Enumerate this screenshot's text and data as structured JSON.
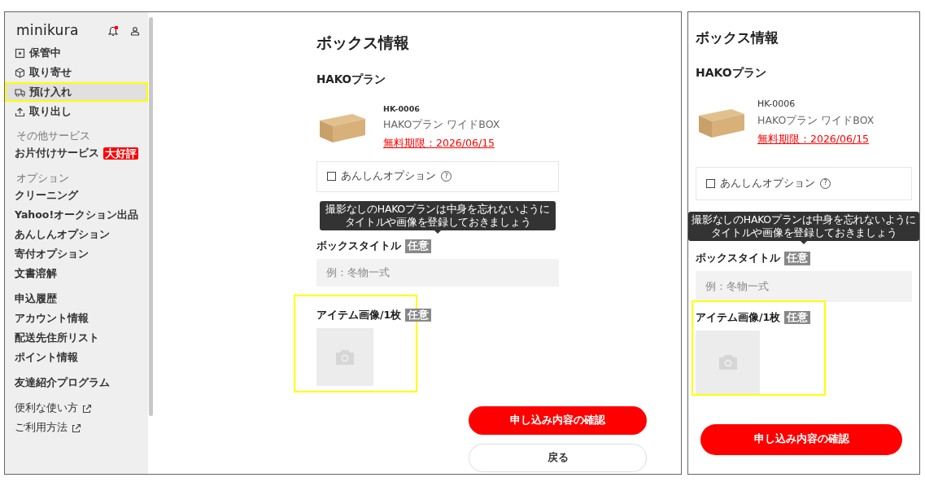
{
  "desktop": {
    "sidebar": {
      "logo": "minikura",
      "has_notification": true,
      "sections": [
        {
          "items": [
            {
              "label": "保管中",
              "kind": "nav",
              "selected": false,
              "highlighted": false
            },
            {
              "label": "取り寄せ",
              "kind": "nav",
              "selected": false,
              "highlighted": false
            },
            {
              "label": "預け入れ",
              "kind": "nav",
              "selected": true,
              "highlighted": true
            },
            {
              "label": "取り出し",
              "kind": "nav",
              "selected": false,
              "highlighted": false
            }
          ]
        },
        {
          "heading": "その他サービス",
          "items": [
            {
              "label": "お片付けサービス",
              "kind": "nav",
              "badge": "大好評",
              "selected": false,
              "highlighted": false
            }
          ]
        },
        {
          "heading": "オプション",
          "items": [
            {
              "label": "クリーニング",
              "kind": "nav",
              "selected": false,
              "highlighted": false
            },
            {
              "label": "Yahoo!オークション出品",
              "kind": "nav",
              "selected": false,
              "highlighted": false
            },
            {
              "label": "あんしんオプション",
              "kind": "nav",
              "selected": false,
              "highlighted": false
            },
            {
              "label": "寄付オプション",
              "kind": "nav",
              "selected": false,
              "highlighted": false
            },
            {
              "label": "文書溶解",
              "kind": "nav",
              "selected": false,
              "highlighted": false
            }
          ]
        },
        {
          "items": [
            {
              "label": "申込履歴",
              "kind": "nav",
              "selected": false,
              "highlighted": false
            },
            {
              "label": "アカウント情報",
              "kind": "nav",
              "selected": false,
              "highlighted": false
            },
            {
              "label": "配送先住所リスト",
              "kind": "nav",
              "selected": false,
              "highlighted": false
            },
            {
              "label": "ポイント情報",
              "kind": "nav",
              "selected": false,
              "highlighted": false
            }
          ]
        },
        {
          "items": [
            {
              "label": "友達紹介プログラム",
              "kind": "nav",
              "selected": false,
              "highlighted": false
            }
          ]
        },
        {
          "items": [
            {
              "label": "便利な使い方",
              "kind": "external",
              "selected": false,
              "highlighted": false
            },
            {
              "label": "ご利用方法",
              "kind": "external",
              "selected": false,
              "highlighted": false
            }
          ]
        }
      ]
    },
    "main": {
      "title": "ボックス情報",
      "plan_title": "HAKOプラン",
      "product": {
        "code": "HK-0006",
        "name": "HAKOプラン ワイドBOX",
        "deadline": "無料期限：2026/06/15"
      },
      "option": {
        "label": "あんしんオプション",
        "checked": false,
        "help": "?"
      },
      "tooltip": {
        "lines": [
          "撮影なしのHAKOプランは中身を忘れないように",
          "タイトルや画像を登録しておきましょう"
        ]
      },
      "box_title": {
        "label": "ボックスタイトル",
        "tag": "任意",
        "placeholder": "例：冬物一式"
      },
      "item_image": {
        "label": "アイテム画像/1枚",
        "tag": "任意",
        "highlighted": true
      },
      "buttons": [
        {
          "label": "申し込み内容の確認",
          "kind": "primary"
        },
        {
          "label": "戻る",
          "kind": "secondary"
        }
      ]
    }
  },
  "mobile": {
    "title": "ボックス情報",
    "plan_title": "HAKOプラン",
    "product": {
      "code": "HK-0006",
      "name": "HAKOプラン ワイドBOX",
      "deadline": "無料期限：2026/06/15"
    },
    "option": {
      "label": "あんしんオプション",
      "checked": false,
      "help": "?"
    },
    "tooltip": {
      "lines": [
        "撮影なしのHAKOプランは中身を忘れないように",
        "タイトルや画像を登録しておきましょう"
      ]
    },
    "box_title": {
      "label": "ボックスタイトル",
      "tag": "任意",
      "placeholder": "例：冬物一式"
    },
    "item_image": {
      "label": "アイテム画像/1枚",
      "tag": "任意",
      "highlighted": true
    },
    "buttons": [
      {
        "label": "申し込み内容の確認",
        "kind": "primary"
      }
    ]
  }
}
